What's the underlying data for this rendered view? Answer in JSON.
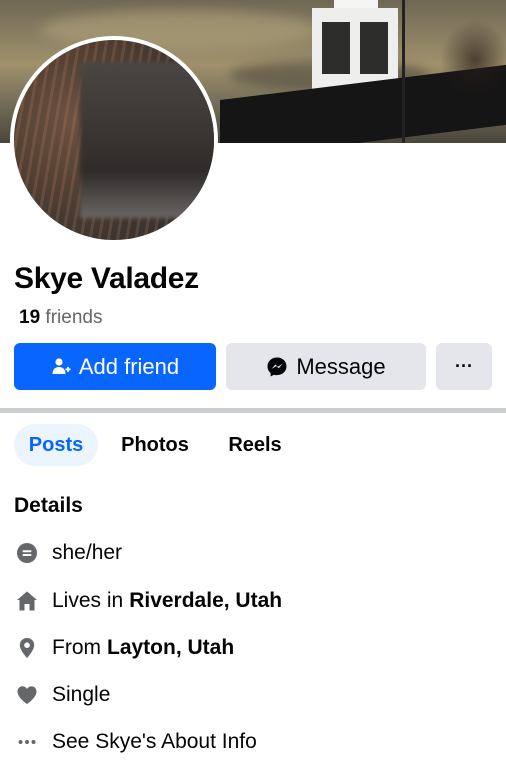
{
  "profile": {
    "name": "Skye Valadez",
    "friends_count": "19",
    "friends_label": "friends"
  },
  "actions": {
    "add_friend": "Add friend",
    "message": "Message",
    "more": "···"
  },
  "tabs": [
    {
      "label": "Posts",
      "active": true
    },
    {
      "label": "Photos",
      "active": false
    },
    {
      "label": "Reels",
      "active": false
    }
  ],
  "details": {
    "title": "Details",
    "pronouns": "she/her",
    "lives_prefix": "Lives in",
    "lives_place": "Riverdale, Utah",
    "from_prefix": "From",
    "from_place": "Layton, Utah",
    "relationship": "Single",
    "about_link": "See Skye's About Info"
  },
  "icons": {
    "pronouns": "speech-bubble-icon",
    "lives": "home-icon",
    "from": "location-pin-icon",
    "relationship": "heart-icon",
    "about": "more-dots-icon",
    "add_friend": "add-person-icon",
    "message": "messenger-icon"
  },
  "colors": {
    "primary": "#0866ff",
    "secondary_button": "#e4e6eb",
    "muted_text": "#65676b",
    "icon_gray": "#65676b",
    "active_tab_bg": "#ebf5ff"
  }
}
